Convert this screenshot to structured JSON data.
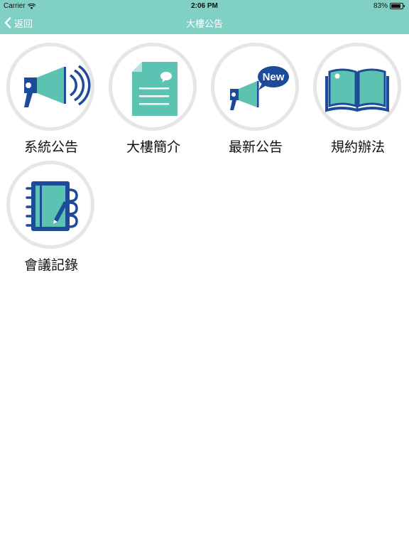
{
  "status_bar": {
    "carrier": "Carrier",
    "time": "2:06 PM",
    "battery": "83%"
  },
  "nav": {
    "back_label": "返回",
    "title": "大樓公告"
  },
  "tiles": [
    {
      "label": "系統公告",
      "icon": "megaphone-icon"
    },
    {
      "label": "大樓簡介",
      "icon": "document-icon"
    },
    {
      "label": "最新公告",
      "icon": "new-megaphone-icon",
      "badge": "New"
    },
    {
      "label": "規約辦法",
      "icon": "book-icon"
    },
    {
      "label": "會議記錄",
      "icon": "notebook-icon"
    }
  ],
  "colors": {
    "header": "#80d0c4",
    "teal": "#5cc2b1",
    "navy": "#1e4a9a",
    "ring": "#e6e6e6"
  }
}
